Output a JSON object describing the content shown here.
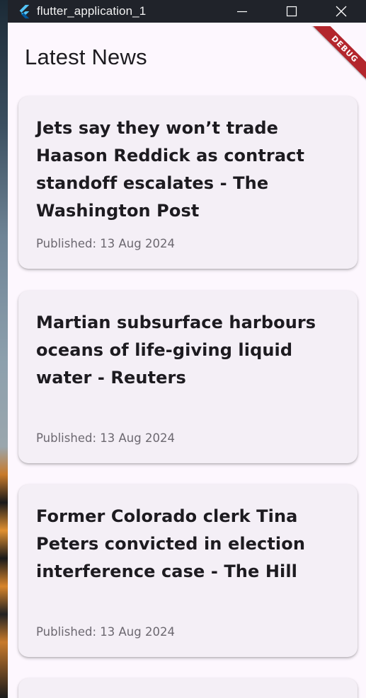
{
  "window": {
    "title": "flutter_application_1",
    "controls": {
      "minimize": "minimize-icon",
      "maximize": "maximize-icon",
      "close": "close-icon"
    }
  },
  "appbar": {
    "title": "Latest News"
  },
  "debug_banner": {
    "label": "DEBUG"
  },
  "articles": [
    {
      "headline": "Jets say they won’t trade Haason Reddick as contract standoff escalates - The Washington Post",
      "published": "Published: 13 Aug 2024"
    },
    {
      "headline": "Martian subsurface harbours oceans of life-giving liquid water - Reuters",
      "published": "Published: 13 Aug 2024"
    },
    {
      "headline": "Former Colorado clerk Tina Peters convicted in election interference case - The Hill",
      "published": "Published: 13 Aug 2024"
    }
  ],
  "colors": {
    "background": "#fdf7fe",
    "card": "#f4eff6",
    "text": "#1d1b20",
    "muted": "#6c6870",
    "debug": "#b3262d",
    "titlebar": "#20232a"
  }
}
